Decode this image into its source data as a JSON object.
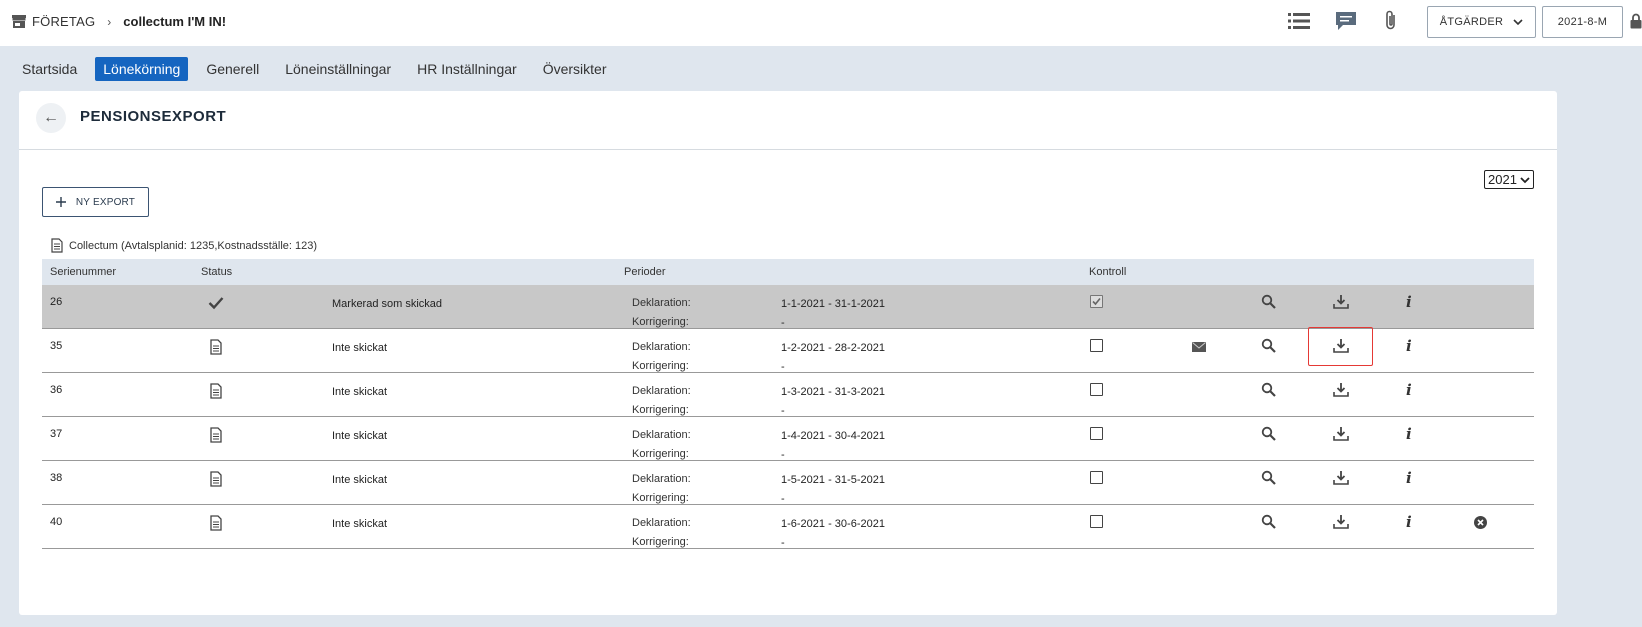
{
  "topbar": {
    "company": "FÖRETAG",
    "client": "collectum I'M IN!",
    "actions_label": "ÅTGÄRDER",
    "period_label": "2021-8-M"
  },
  "nav": {
    "tabs": [
      {
        "label": "Startsida"
      },
      {
        "label": "Lönekörning"
      },
      {
        "label": "Generell"
      },
      {
        "label": "Löneinställningar"
      },
      {
        "label": "HR Inställningar"
      },
      {
        "label": "Översikter"
      }
    ],
    "active": "Lönekörning"
  },
  "page": {
    "title": "PENSIONSEXPORT",
    "new_export_label": "NY EXPORT",
    "year": "2021",
    "collectum_label": "Collectum (Avtalsplanid: 1235,Kostnadsställe: 123)"
  },
  "table": {
    "headers": {
      "serial": "Serienummer",
      "status": "Status",
      "periods": "Perioder",
      "control": "Kontroll"
    },
    "deklaration_label": "Deklaration:",
    "korrigering_label": "Korrigering:",
    "rows": [
      {
        "serial": "26",
        "status": "Markerad som skickad",
        "sent": true,
        "deklaration": "1-1-2021 - 31-1-2021",
        "korrigering": "-",
        "checked": true
      },
      {
        "serial": "35",
        "status": "Inte skickat",
        "sent": false,
        "deklaration": "1-2-2021 - 28-2-2021",
        "korrigering": "-",
        "checked": false
      },
      {
        "serial": "36",
        "status": "Inte skickat",
        "sent": false,
        "deklaration": "1-3-2021 - 31-3-2021",
        "korrigering": "-",
        "checked": false
      },
      {
        "serial": "37",
        "status": "Inte skickat",
        "sent": false,
        "deklaration": "1-4-2021 - 30-4-2021",
        "korrigering": "-",
        "checked": false
      },
      {
        "serial": "38",
        "status": "Inte skickat",
        "sent": false,
        "deklaration": "1-5-2021 - 31-5-2021",
        "korrigering": "-",
        "checked": false
      },
      {
        "serial": "40",
        "status": "Inte skickat",
        "sent": false,
        "deklaration": "1-6-2021 - 30-6-2021",
        "korrigering": "-",
        "checked": false
      }
    ]
  },
  "colors": {
    "accent": "#1565c0",
    "highlight": "#e53935",
    "sent_row": "#c8c8c8",
    "page_bg": "#dfe6ee"
  }
}
